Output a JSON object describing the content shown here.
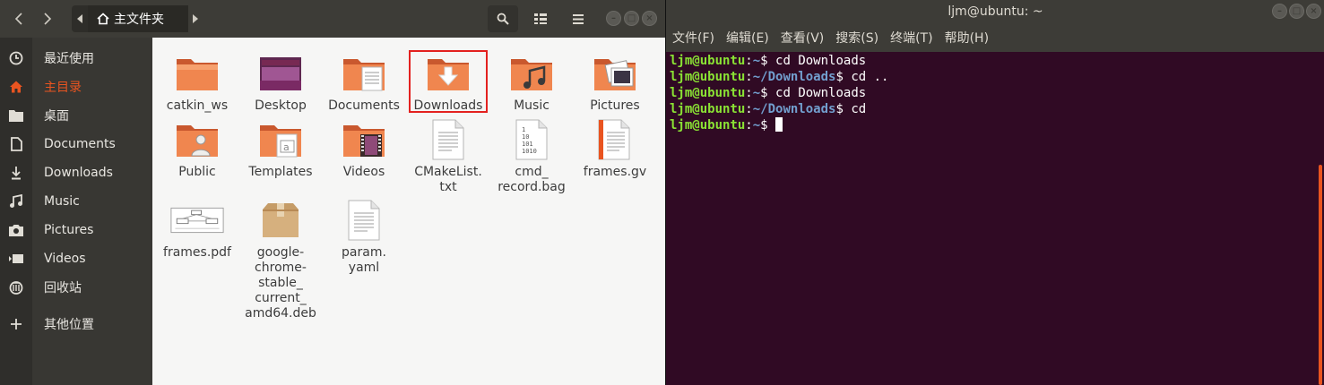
{
  "file_manager": {
    "location": "主文件夹",
    "sidebar": [
      {
        "label": "最近使用",
        "icon": "clock-icon",
        "active": false
      },
      {
        "label": "主目录",
        "icon": "home-icon",
        "active": true
      },
      {
        "label": "桌面",
        "icon": "folder-icon",
        "active": false
      },
      {
        "label": "Documents",
        "icon": "document-icon",
        "active": false
      },
      {
        "label": "Downloads",
        "icon": "download-icon",
        "active": false
      },
      {
        "label": "Music",
        "icon": "music-icon",
        "active": false
      },
      {
        "label": "Pictures",
        "icon": "camera-icon",
        "active": false
      },
      {
        "label": "Videos",
        "icon": "video-icon",
        "active": false
      },
      {
        "label": "回收站",
        "icon": "trash-icon",
        "active": false
      },
      {
        "label": "其他位置",
        "icon": "plus-icon",
        "active": false
      }
    ],
    "files": [
      {
        "name": "catkin_ws",
        "type": "folder"
      },
      {
        "name": "Desktop",
        "type": "desktop-folder"
      },
      {
        "name": "Documents",
        "type": "documents-folder"
      },
      {
        "name": "Downloads",
        "type": "downloads-folder",
        "highlighted": true
      },
      {
        "name": "Music",
        "type": "music-folder"
      },
      {
        "name": "Pictures",
        "type": "pictures-folder"
      },
      {
        "name": "Public",
        "type": "public-folder"
      },
      {
        "name": "Templates",
        "type": "templates-folder"
      },
      {
        "name": "Videos",
        "type": "videos-folder"
      },
      {
        "name": "CMakeList.\ntxt",
        "type": "text-file"
      },
      {
        "name": "cmd_\nrecord.bag",
        "type": "binary-file"
      },
      {
        "name": "frames.gv",
        "type": "gv-file"
      },
      {
        "name": "frames.pdf",
        "type": "pdf-file"
      },
      {
        "name": "google-\nchrome-\nstable_\ncurrent_\namd64.deb",
        "type": "package-file"
      },
      {
        "name": "param.\nyaml",
        "type": "text-file"
      }
    ]
  },
  "terminal": {
    "title": "ljm@ubuntu: ~",
    "menu": [
      "文件(F)",
      "编辑(E)",
      "查看(V)",
      "搜索(S)",
      "终端(T)",
      "帮助(H)"
    ],
    "lines": [
      {
        "user": "ljm@ubuntu",
        "path": "~",
        "cmd": "cd Downloads"
      },
      {
        "user": "ljm@ubuntu",
        "path": "~/Downloads",
        "cmd": "cd .."
      },
      {
        "user": "ljm@ubuntu",
        "path": "~",
        "cmd": "cd Downloads"
      },
      {
        "user": "ljm@ubuntu",
        "path": "~/Downloads",
        "cmd": "cd"
      },
      {
        "user": "ljm@ubuntu",
        "path": "~",
        "cmd": ""
      }
    ]
  },
  "colors": {
    "accent": "#e95420",
    "header": "#3d3c37",
    "sidebar": "#383733",
    "terminal_bg": "#300a24",
    "prompt_user": "#8ae234",
    "prompt_path": "#729fcf",
    "highlight_frame": "#e3211f"
  }
}
